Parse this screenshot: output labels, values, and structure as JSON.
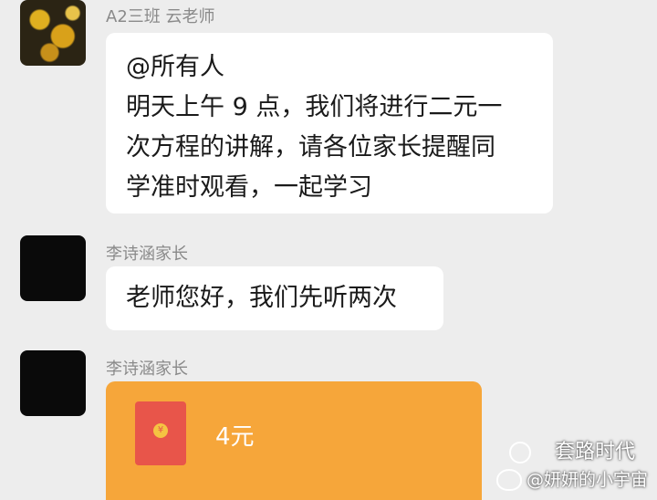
{
  "messages": [
    {
      "sender": "A2三班 云老师",
      "lines": [
        "@所有人",
        "明天上午 9 点，我们将进行二元一",
        "次方程的讲解，请各位家长提醒同",
        "学准时观看，一起学习"
      ]
    },
    {
      "sender": "李诗涵家长",
      "text": "老师您好，我们先听两次"
    },
    {
      "sender": "李诗涵家长",
      "red_packet": {
        "coin_symbol": "¥",
        "amount": "4元"
      }
    }
  ],
  "watermark": {
    "line1": "套路时代",
    "line2": "@妍妍的小宇宙"
  },
  "colors": {
    "red_packet": "#f6a63a",
    "envelope": "#e8554a",
    "background": "#ededed"
  },
  "icons": [
    "wechat-channel-icon",
    "weibo-icon"
  ]
}
